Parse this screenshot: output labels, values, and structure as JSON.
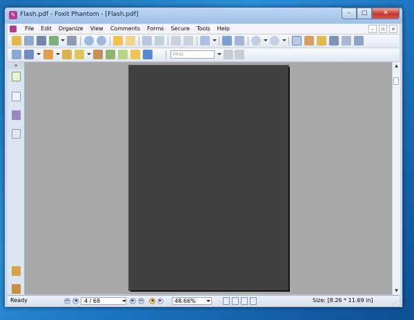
{
  "window": {
    "title": "Flash.pdf - Foxit Phantom - [Flash.pdf]",
    "controls": {
      "minimize": "–",
      "maximize": "□",
      "close": "✕"
    }
  },
  "menubar": {
    "items": [
      "File",
      "Edit",
      "Organize",
      "View",
      "Comments",
      "Forms",
      "Secure",
      "Tools",
      "Help"
    ],
    "doc_controls": [
      "–",
      "▫",
      "×"
    ]
  },
  "toolbar": {
    "find_placeholder": "Find"
  },
  "sidebar": {
    "collapse_label": "»"
  },
  "statusbar": {
    "status": "Ready",
    "page_display": "4 / 68",
    "zoom": "48.66%",
    "size_text": "Size: [8.26 * 11.69 in]"
  },
  "colors": {
    "accent": "#b33e8f",
    "page": "#404040",
    "viewer_bg": "#a9a9a9"
  }
}
